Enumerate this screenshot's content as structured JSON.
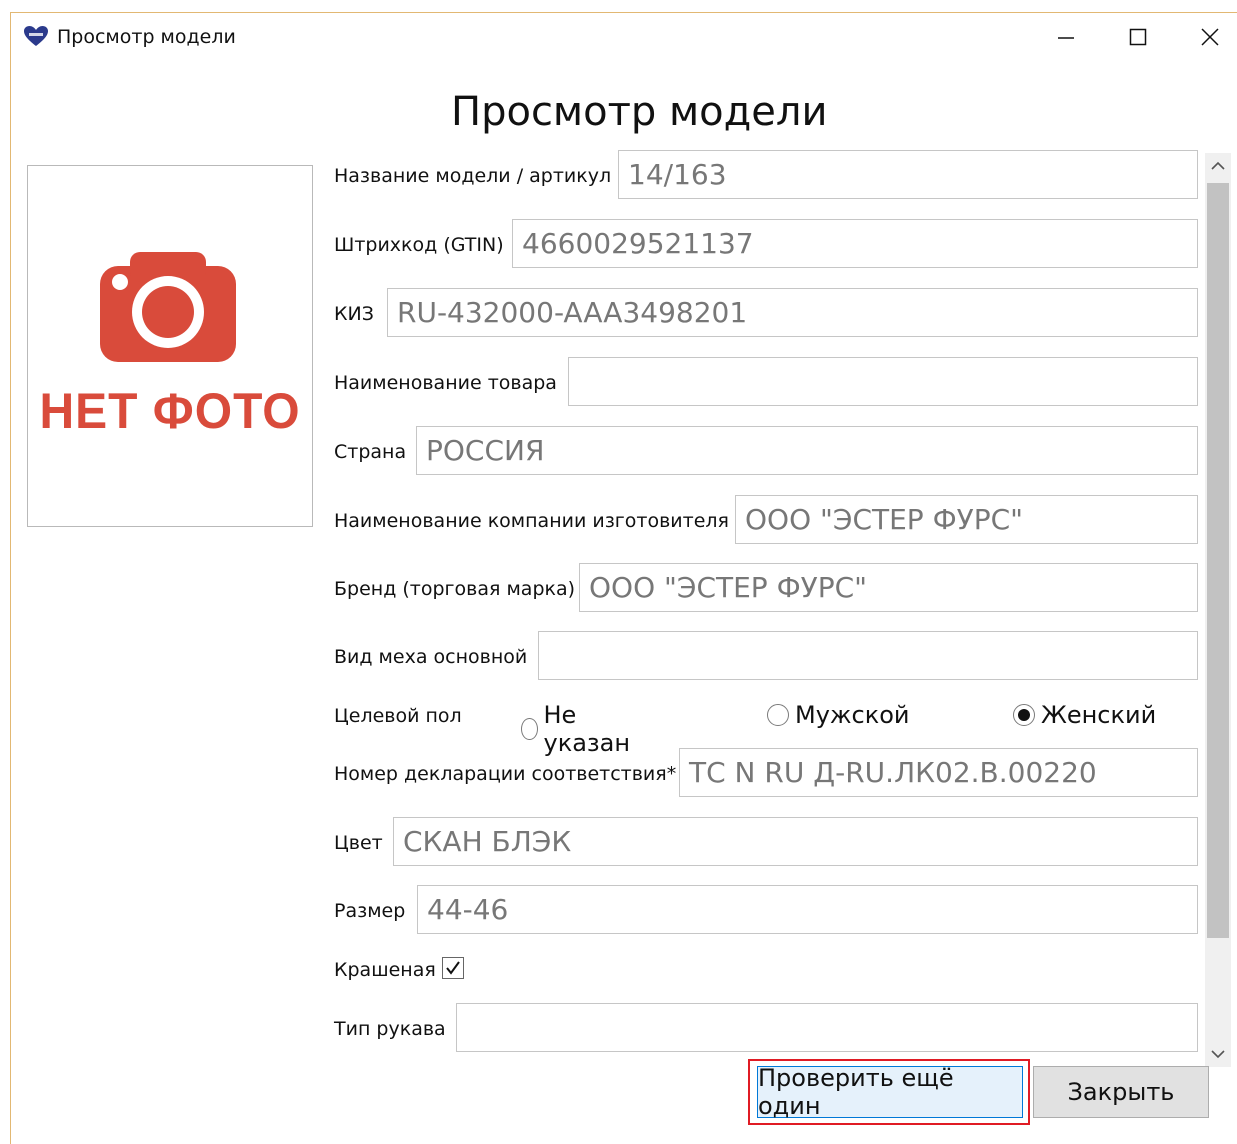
{
  "window": {
    "title": "Просмотр модели"
  },
  "heading": "Просмотр модели",
  "photo": {
    "placeholder_text": "НЕТ ФОТО"
  },
  "fields": {
    "model": {
      "label": "Название модели / артикул",
      "value": "14/163"
    },
    "barcode": {
      "label": "Штрихкод (GTIN)",
      "value": "4660029521137"
    },
    "kiz": {
      "label": "КИЗ",
      "value": "RU-432000-AAA3498201"
    },
    "product_name": {
      "label": "Наименование товара",
      "value": ""
    },
    "country": {
      "label": "Страна",
      "value": "РОССИЯ"
    },
    "manufacturer": {
      "label": "Наименование компании изготовителя",
      "value": "ООО \"ЭСТЕР ФУРС\""
    },
    "brand": {
      "label": "Бренд (торговая марка)",
      "value": "ООО \"ЭСТЕР ФУРС\""
    },
    "fur_type": {
      "label": "Вид меха основной",
      "value": ""
    },
    "declaration": {
      "label": "Номер декларации соответствия*",
      "value": "ТС N RU Д-RU.ЛК02.В.00220"
    },
    "color": {
      "label": "Цвет",
      "value": "СКАН БЛЭК"
    },
    "size": {
      "label": "Размер",
      "value": "44-46"
    },
    "sleeve": {
      "label": "Тип рукава",
      "value": ""
    }
  },
  "gender": {
    "label": "Целевой пол",
    "options": [
      {
        "label": "Не указан",
        "selected": false
      },
      {
        "label": "Мужской",
        "selected": false
      },
      {
        "label": "Женский",
        "selected": true
      }
    ]
  },
  "dyed": {
    "label": "Крашеная",
    "checked": true
  },
  "buttons": {
    "check_another": "Проверить ещё один",
    "close": "Закрыть"
  },
  "colors": {
    "accent": "#0078d7",
    "highlight": "#e01b24",
    "no_photo": "#d94b3b"
  },
  "icons": {
    "app": "heart-icon",
    "camera": "camera-icon"
  }
}
